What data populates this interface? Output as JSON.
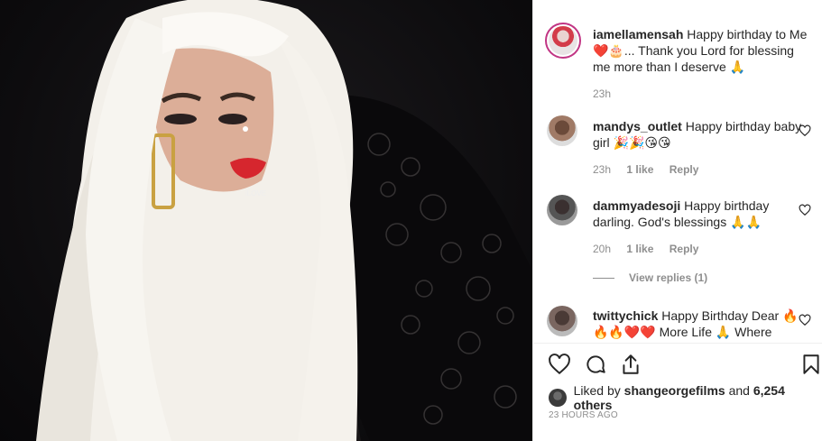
{
  "post": {
    "username": "iamellamensah",
    "caption": "Happy birthday to Me ❤️🎂... Thank you Lord for blessing me more than I deserve 🙏",
    "time": "23h"
  },
  "comments": [
    {
      "username": "mandys_outlet",
      "text": "Happy birthday baby girl 🎉🎉😘😘",
      "time": "23h",
      "likes": "1 like",
      "reply": "Reply"
    },
    {
      "username": "dammyadesoji",
      "text": "Happy birthday darling. God's blessings 🙏🙏",
      "time": "20h",
      "likes": "1 like",
      "reply": "Reply"
    },
    {
      "username": "twittychick",
      "text": "Happy Birthday Dear 🔥🔥🔥❤️❤️ More Life 🙏 Where"
    }
  ],
  "view_replies": "View replies (1)",
  "liked_by": {
    "prefix": "Liked by",
    "user": "shangeorgefilms",
    "middle": "and",
    "others": "6,254 others"
  },
  "timestamp": "23 HOURS AGO",
  "icons": {
    "like": "heart-icon",
    "comment": "comment-icon",
    "share": "share-icon",
    "save": "bookmark-icon",
    "comment_like": "small-heart-icon"
  }
}
